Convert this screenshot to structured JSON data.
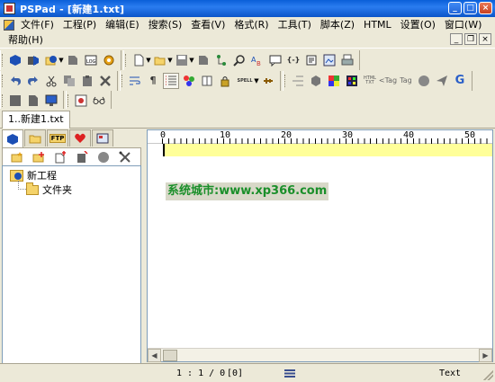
{
  "window": {
    "title": "PSPad - [新建1.txt]",
    "buttons": {
      "minimize": "_",
      "maximize": "□",
      "close": "×"
    }
  },
  "menubar": {
    "row1": [
      "文件(F)",
      "工程(P)",
      "编辑(E)",
      "搜索(S)",
      "查看(V)",
      "格式(R)",
      "工具(T)",
      "脚本(Z)",
      "HTML",
      "设置(O)",
      "窗口(W)"
    ],
    "row2": [
      "帮助(H)"
    ],
    "mdi_buttons": {
      "minimize": "_",
      "restore": "❐",
      "close": "×"
    }
  },
  "toolbar": {
    "spell_label": "SPELL",
    "html_label": "HTML",
    "txt_label": "TXT",
    "tag_label": "Tag",
    "g_label": "G",
    "braces_label": "{-}"
  },
  "doc_tabs": [
    {
      "label": "1..新建1.txt",
      "active": true
    }
  ],
  "panel": {
    "tabs": [
      "project",
      "folder",
      "ftp",
      "favorites",
      "clips"
    ],
    "ftp_label": "FTP",
    "tree": {
      "project": "新工程",
      "folder": "文件夹"
    }
  },
  "editor": {
    "ruler_marks": [
      "0",
      "10",
      "20",
      "30",
      "40",
      "50"
    ],
    "watermark": "系统城市:www.xp366.com"
  },
  "status": {
    "position": "1 : 1 / 0",
    "selection": "[0]",
    "mode": "Text"
  },
  "colors": {
    "titlebar": "#0a5fd8",
    "current_line": "#ffff99",
    "watermark_text": "#1a8f2a"
  }
}
